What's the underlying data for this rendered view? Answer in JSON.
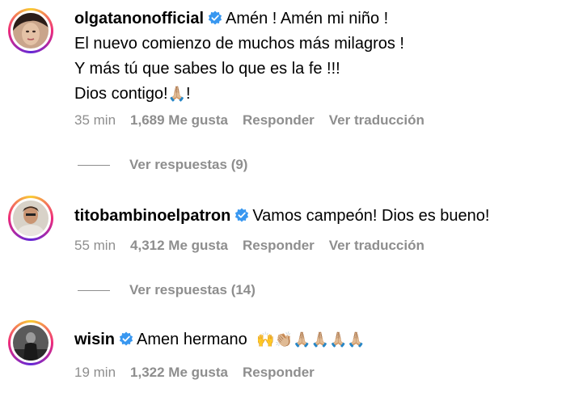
{
  "comments": [
    {
      "username": "olgatanonofficial",
      "lines": [
        "Amén ! Amén mi niño !",
        "El nuevo comienzo de muchos más milagros !",
        "Y más tú que sabes lo que es la fe !!!",
        "Dios contigo!"
      ],
      "line4_emoji": "🙏🏼",
      "line4_tail": "!",
      "time": "35 min",
      "likes": "1,689 Me gusta",
      "reply": "Responder",
      "translate": "Ver traducción",
      "view_replies": "Ver respuestas (9)"
    },
    {
      "username": "titobambinoelpatron",
      "text": "Vamos campeón! Dios es bueno!",
      "time": "55 min",
      "likes": "4,312 Me gusta",
      "reply": "Responder",
      "translate": "Ver traducción",
      "view_replies": "Ver respuestas (14)"
    },
    {
      "username": "wisin",
      "text": "Amen hermano",
      "emojis": "🙌👏🏼🙏🏼🙏🏼🙏🏼🙏🏼",
      "time": "19 min",
      "likes": "1,322 Me gusta",
      "reply": "Responder"
    }
  ],
  "colors": {
    "verified": "#3897f0",
    "meta": "#8e8e8e"
  },
  "icons": {
    "verified": "verified-badge-icon"
  }
}
